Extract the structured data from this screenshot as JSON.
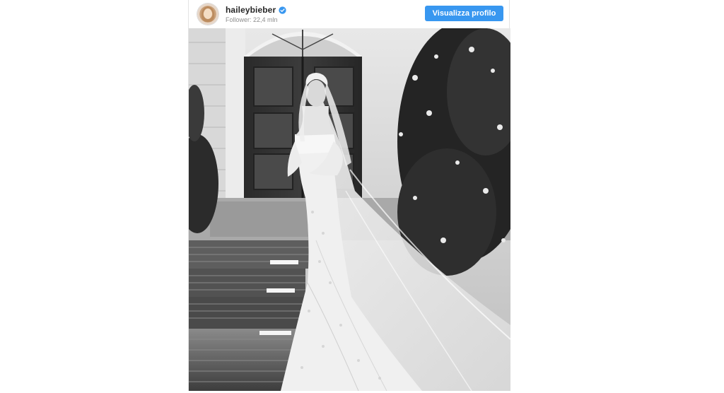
{
  "header": {
    "username": "haileybieber",
    "followers": "Follower: 22,4 mln",
    "view_profile_label": "Visualizza profilo"
  },
  "icons": {
    "verified": "verified-badge-icon"
  },
  "colors": {
    "button_blue": "#3897f0",
    "username_text": "#262626",
    "secondary_text": "#8e8e8e"
  },
  "post": {
    "image_style": "black-and-white"
  }
}
